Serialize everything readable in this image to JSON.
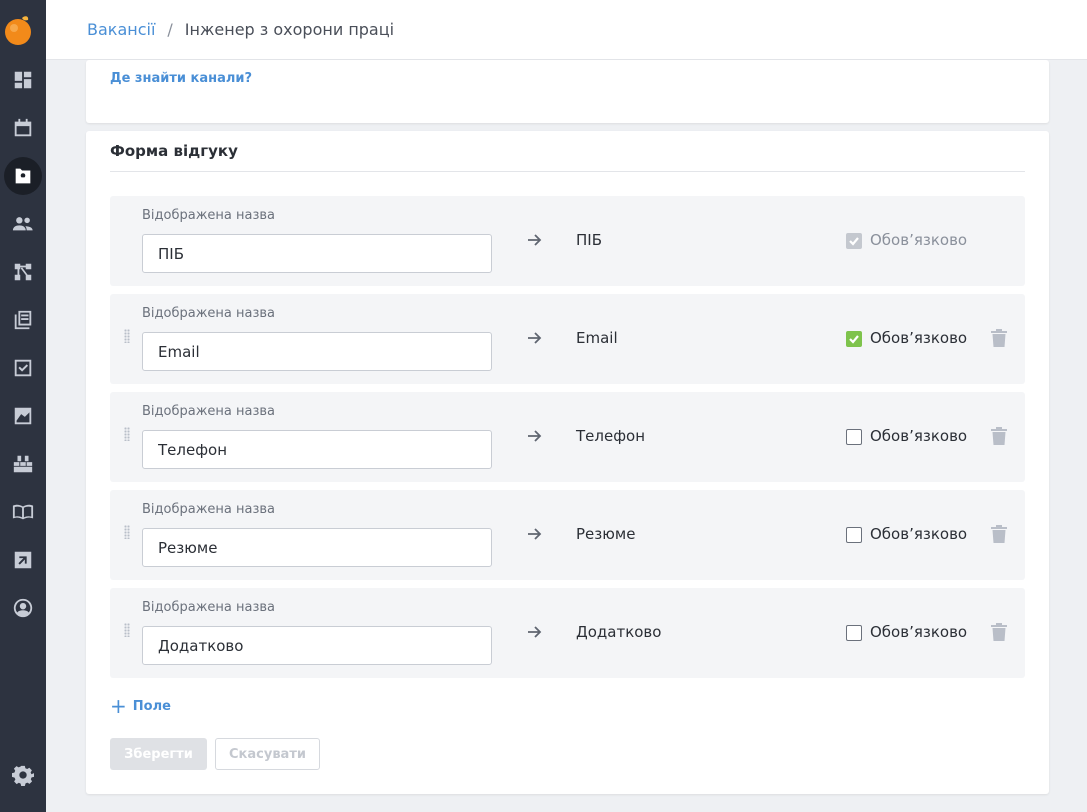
{
  "sidebar": {
    "logo": "orange-fruit-logo",
    "items": [
      {
        "icon": "dashboard-icon"
      },
      {
        "icon": "calendar-icon"
      },
      {
        "icon": "vacancies-icon",
        "active": true
      },
      {
        "icon": "people-icon"
      },
      {
        "icon": "pipeline-icon"
      },
      {
        "icon": "library-icon"
      },
      {
        "icon": "tasks-icon"
      },
      {
        "icon": "analytics-icon"
      },
      {
        "icon": "integrations-icon"
      },
      {
        "icon": "book-icon"
      },
      {
        "icon": "external-link-icon"
      },
      {
        "icon": "profile-icon"
      }
    ],
    "settings_icon": "gear-icon"
  },
  "breadcrumb": {
    "parent": "Вакансії",
    "separator": "/",
    "current": "Інженер з охорони праці"
  },
  "channels": {
    "help_link": "Де знайти канали?"
  },
  "form": {
    "title": "Форма відгуку",
    "fields": [
      {
        "label": "Відображена назва",
        "value": "ПІБ",
        "mapped_to": "ПІБ",
        "required": true,
        "required_label": "Обов’язково",
        "locked": true
      },
      {
        "label": "Відображена назва",
        "value": "Email",
        "mapped_to": "Email",
        "required": true,
        "required_label": "Обов’язково",
        "locked": false
      },
      {
        "label": "Відображена назва",
        "value": "Телефон",
        "mapped_to": "Телефон",
        "required": false,
        "required_label": "Обов’язково",
        "locked": false
      },
      {
        "label": "Відображена назва",
        "value": "Резюме",
        "mapped_to": "Резюме",
        "required": false,
        "required_label": "Обов’язково",
        "locked": false
      },
      {
        "label": "Відображена назва",
        "value": "Додатково",
        "mapped_to": "Додатково",
        "required": false,
        "required_label": "Обов’язково",
        "locked": false
      }
    ],
    "add_field_label": "Поле",
    "save_label": "Зберегти",
    "cancel_label": "Скасувати"
  },
  "colors": {
    "sidebar_bg": "#2d3340",
    "link": "#4a8fd6",
    "checkbox_checked": "#7ec34c"
  }
}
